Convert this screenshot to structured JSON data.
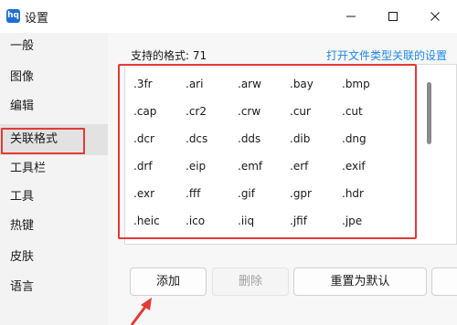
{
  "window": {
    "title": "设置",
    "app_icon_glyph": "hq",
    "controls": [
      "minimize-icon",
      "maximize-icon",
      "close-icon"
    ]
  },
  "sidebar": {
    "items": [
      {
        "label": "一般"
      },
      {
        "label": "图像"
      },
      {
        "label": "编辑"
      },
      {
        "label": "关联格式",
        "active": true
      },
      {
        "label": "工具栏"
      },
      {
        "label": "工具"
      },
      {
        "label": "热键"
      },
      {
        "label": "皮肤"
      },
      {
        "label": "语言"
      }
    ]
  },
  "main": {
    "formats_label": "支持的格式: 71",
    "assoc_link": "打开文件类型关联的设置",
    "formats_rows": [
      [
        ".3fr",
        ".ari",
        ".arw",
        ".bay",
        ".bmp"
      ],
      [
        ".cap",
        ".cr2",
        ".crw",
        ".cur",
        ".cut"
      ],
      [
        ".dcr",
        ".dcs",
        ".dds",
        ".dib",
        ".dng"
      ],
      [
        ".drf",
        ".eip",
        ".emf",
        ".erf",
        ".exif"
      ],
      [
        ".exr",
        ".fff",
        ".gif",
        ".gpr",
        ".hdr"
      ],
      [
        ".heic",
        ".ico",
        ".iiq",
        ".jfif",
        ".jpe"
      ]
    ],
    "buttons": {
      "add": "添加",
      "delete": "删除",
      "reset": "重置为默认"
    }
  },
  "colors": {
    "highlight_red": "#e53935",
    "link_blue": "#1e88e5",
    "app_icon_blue": "#1f6fd1"
  }
}
